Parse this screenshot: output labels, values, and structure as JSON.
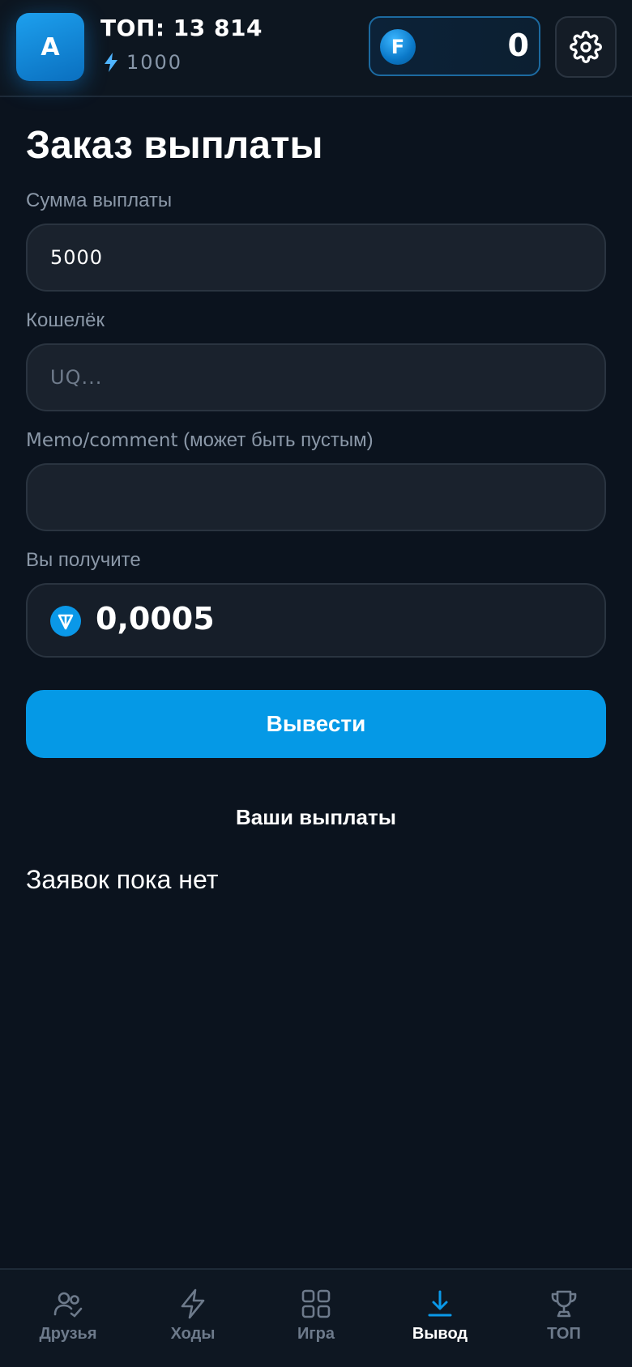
{
  "header": {
    "avatar_letter": "A",
    "top_rank": "ТОП: 13 814",
    "energy": "1000",
    "coin_letter": "F",
    "balance": "0"
  },
  "form": {
    "title": "Заказ выплаты",
    "amount_label": "Сумма выплаты",
    "amount_value": "5000",
    "wallet_label": "Кошелёк",
    "wallet_placeholder": "UQ...",
    "memo_label_main": "Memo/comment",
    "memo_label_hint": "(может быть пустым)",
    "memo_value": "",
    "receive_label": "Вы получите",
    "receive_value": "0,0005",
    "submit_label": "Вывести"
  },
  "payouts": {
    "heading": "Ваши выплаты",
    "empty_text": "Заявок пока нет"
  },
  "nav": {
    "items": [
      {
        "label": "Друзья",
        "icon": "friends-icon"
      },
      {
        "label": "Ходы",
        "icon": "lightning-icon"
      },
      {
        "label": "Игра",
        "icon": "grid-icon"
      },
      {
        "label": "Вывод",
        "icon": "download-icon",
        "active": true
      },
      {
        "label": "ТОП",
        "icon": "trophy-icon"
      }
    ]
  },
  "colors": {
    "background": "#0b131e",
    "accent": "#0599e6",
    "muted_text": "#8b98a8",
    "field_bg": "#1a222d"
  }
}
